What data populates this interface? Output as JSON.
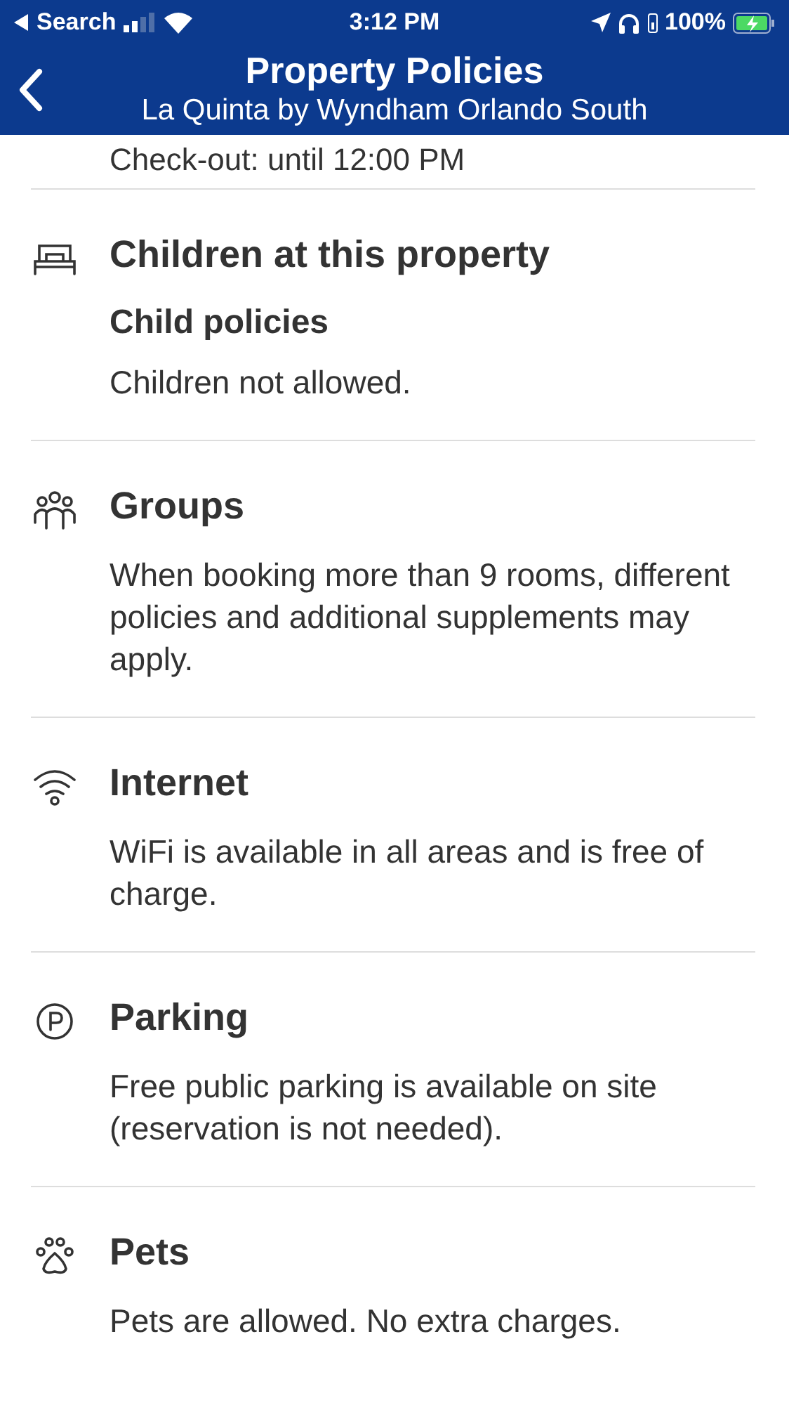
{
  "status_bar": {
    "back_label": "Search",
    "time": "3:12 PM",
    "battery": "100%"
  },
  "header": {
    "title": "Property Policies",
    "subtitle": "La Quinta by Wyndham Orlando South"
  },
  "partial_text": "Check-out: until 12:00 PM",
  "sections": [
    {
      "title": "Children at this property",
      "items": [
        {
          "subtitle": "Child policies",
          "text": "Children not allowed."
        }
      ]
    },
    {
      "title": "Groups",
      "items": [
        {
          "text": "When booking more than 9 rooms, different policies and additional supplements may apply."
        }
      ]
    },
    {
      "title": "Internet",
      "items": [
        {
          "text": "WiFi is available in all areas and is free of charge."
        }
      ]
    },
    {
      "title": "Parking",
      "items": [
        {
          "text": "Free public parking is available on site (reservation is not needed)."
        }
      ]
    },
    {
      "title": "Pets",
      "items": [
        {
          "text": "Pets are allowed. No extra charges."
        }
      ]
    }
  ]
}
